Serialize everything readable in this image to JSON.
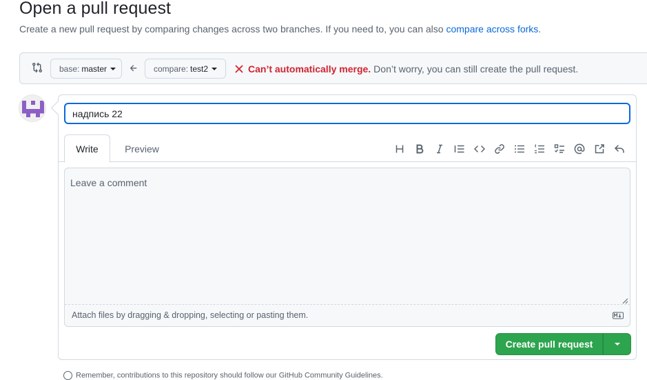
{
  "page": {
    "title": "Open a pull request",
    "subtitle_prefix": "Create a new pull request by comparing changes across two branches. If you need to, you can also ",
    "subtitle_link": "compare across forks",
    "subtitle_suffix": "."
  },
  "range": {
    "base_label": "base:",
    "base_branch": "master",
    "compare_label": "compare:",
    "compare_branch": "test2",
    "merge_status_strong": "Can’t automatically merge.",
    "merge_status_text": "Don’t worry, you can still create the pull request.",
    "status_color": "#d1242f"
  },
  "form": {
    "title_value": "надпись 22",
    "tabs": [
      {
        "label": "Write",
        "selected": true
      },
      {
        "label": "Preview",
        "selected": false
      }
    ],
    "toolbar_icons": [
      "heading-icon",
      "bold-icon",
      "italic-icon",
      "quote-icon",
      "code-icon",
      "link-icon",
      "unordered-list-icon",
      "ordered-list-icon",
      "task-list-icon",
      "mention-icon",
      "cross-reference-icon",
      "reply-icon"
    ],
    "comment_placeholder": "Leave a comment",
    "attach_text": "Attach files by dragging & dropping, selecting or pasting them.",
    "submit_label": "Create pull request",
    "submit_color": "#2da44e"
  },
  "footer": {
    "peek_text": "Remember, contributions to this repository should follow our GitHub Community Guidelines."
  }
}
